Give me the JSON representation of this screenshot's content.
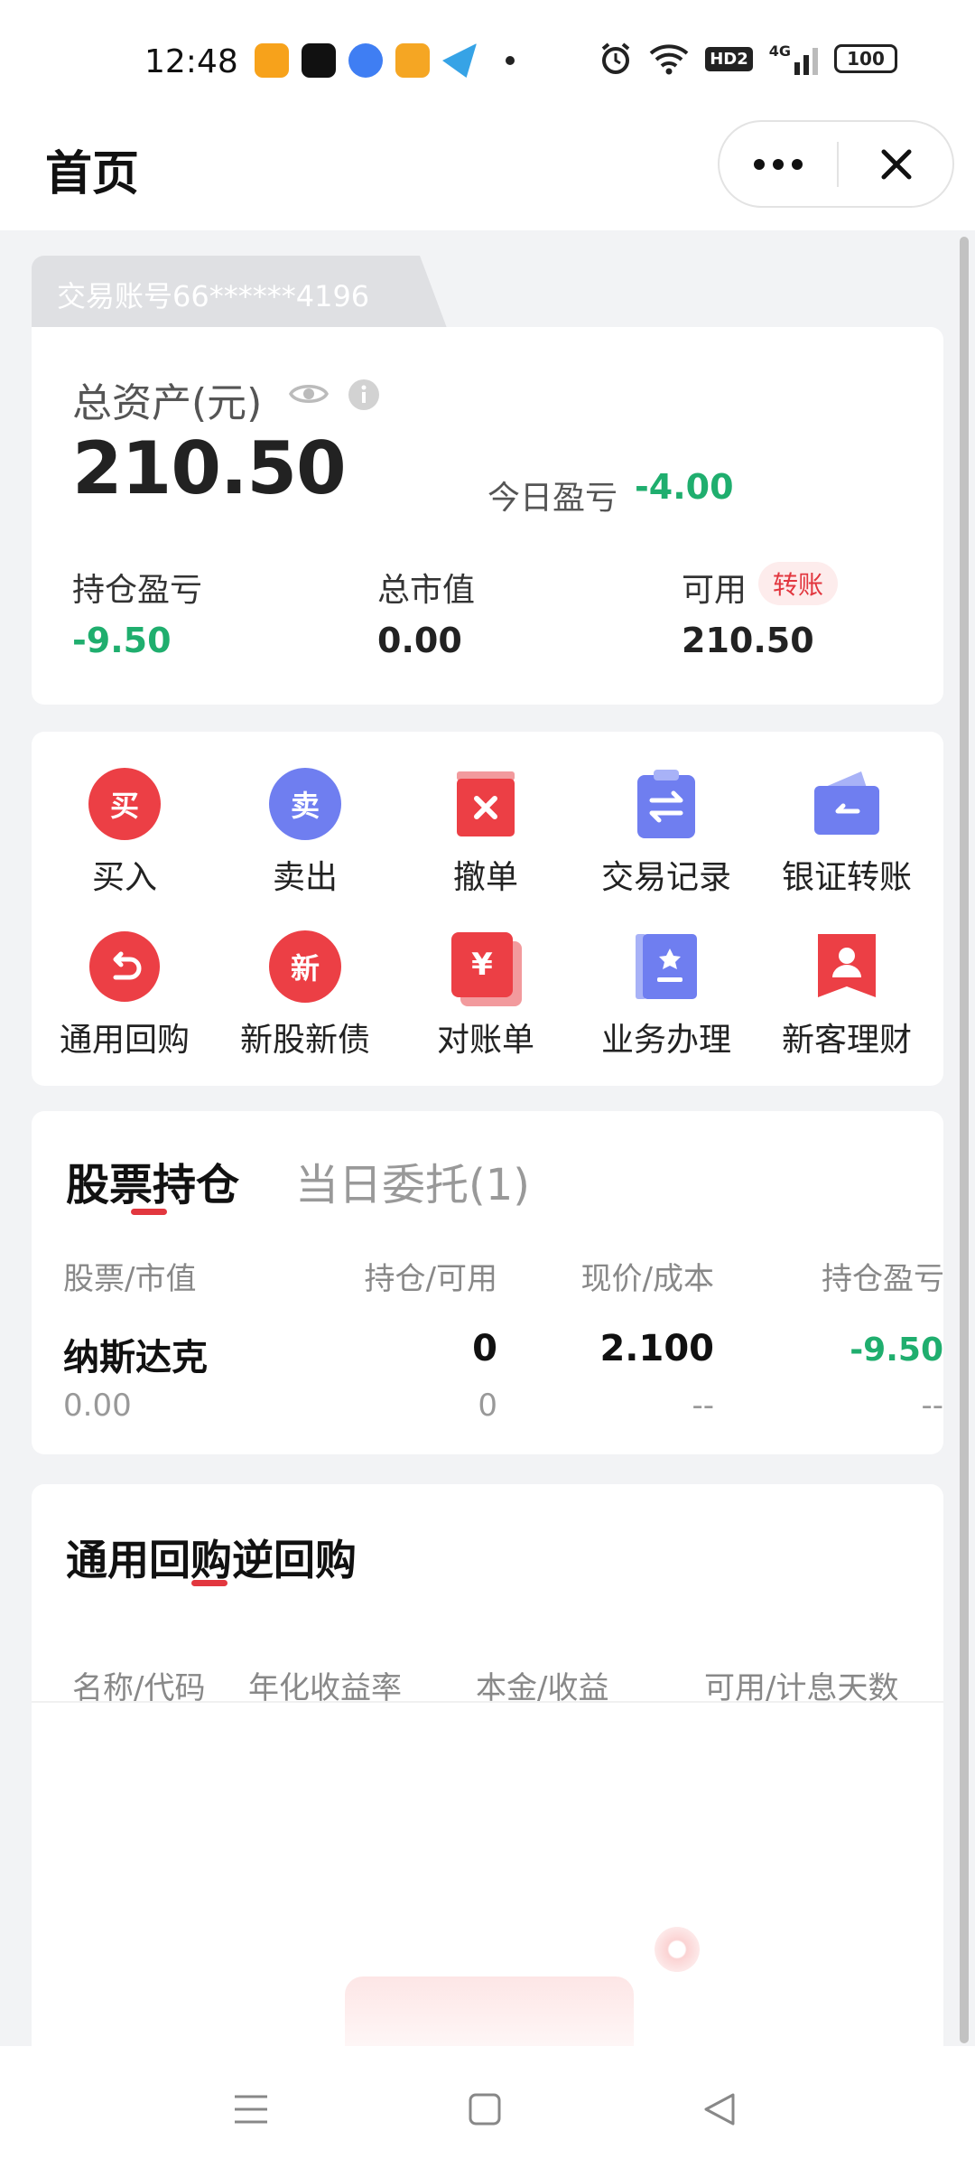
{
  "status_bar": {
    "time": "12:48",
    "network": "4G",
    "hd": "HD2",
    "battery": "100",
    "icons": [
      "alarm-icon",
      "wifi-icon",
      "signal-icon",
      "battery-icon"
    ]
  },
  "header": {
    "title": "首页",
    "more_icon": "more-icon",
    "close_icon": "close-icon"
  },
  "account": {
    "label": "交易账号66******4196",
    "total_label": "总资产(元)",
    "total_value": "210.50",
    "today_label": "今日盈亏",
    "today_value": "-4.00",
    "stats": [
      {
        "label": "持仓盈亏",
        "value": "-9.50"
      },
      {
        "label": "总市值",
        "value": "0.00"
      },
      {
        "label": "可用",
        "value": "210.50"
      }
    ],
    "transfer_badge": "转账"
  },
  "menu": {
    "items": [
      {
        "label": "买入",
        "glyph": "买",
        "icon": "buy-icon"
      },
      {
        "label": "卖出",
        "glyph": "卖",
        "icon": "sell-icon"
      },
      {
        "label": "撤单",
        "icon": "cancel-order-icon"
      },
      {
        "label": "交易记录",
        "icon": "trade-record-icon"
      },
      {
        "label": "银证转账",
        "icon": "bank-transfer-icon"
      },
      {
        "label": "通用回购",
        "icon": "repo-icon"
      },
      {
        "label": "新股新债",
        "glyph": "新",
        "icon": "ipo-icon"
      },
      {
        "label": "对账单",
        "glyph": "¥",
        "icon": "statement-icon"
      },
      {
        "label": "业务办理",
        "icon": "business-icon"
      },
      {
        "label": "新客理财",
        "icon": "new-client-icon"
      }
    ]
  },
  "holdings": {
    "tab_active": "股票持仓",
    "tab_inactive": "当日委托(1)",
    "columns": [
      "股票/市值",
      "持仓/可用",
      "现价/成本",
      "持仓盈亏"
    ],
    "rows": [
      {
        "name": "纳斯达克",
        "market_value": "0.00",
        "position": "0",
        "available": "0",
        "price": "2.100",
        "cost": "--",
        "pnl": "-9.50",
        "pnl_sub": "--"
      }
    ]
  },
  "repo": {
    "title": "通用回购逆回购",
    "columns": [
      "名称/代码",
      "年化收益率",
      "本金/收益",
      "可用/计息天数"
    ]
  },
  "colors": {
    "accent_red": "#e2373f",
    "profit_green": "#1fae6e",
    "icon_blue": "#6f7ef0"
  }
}
